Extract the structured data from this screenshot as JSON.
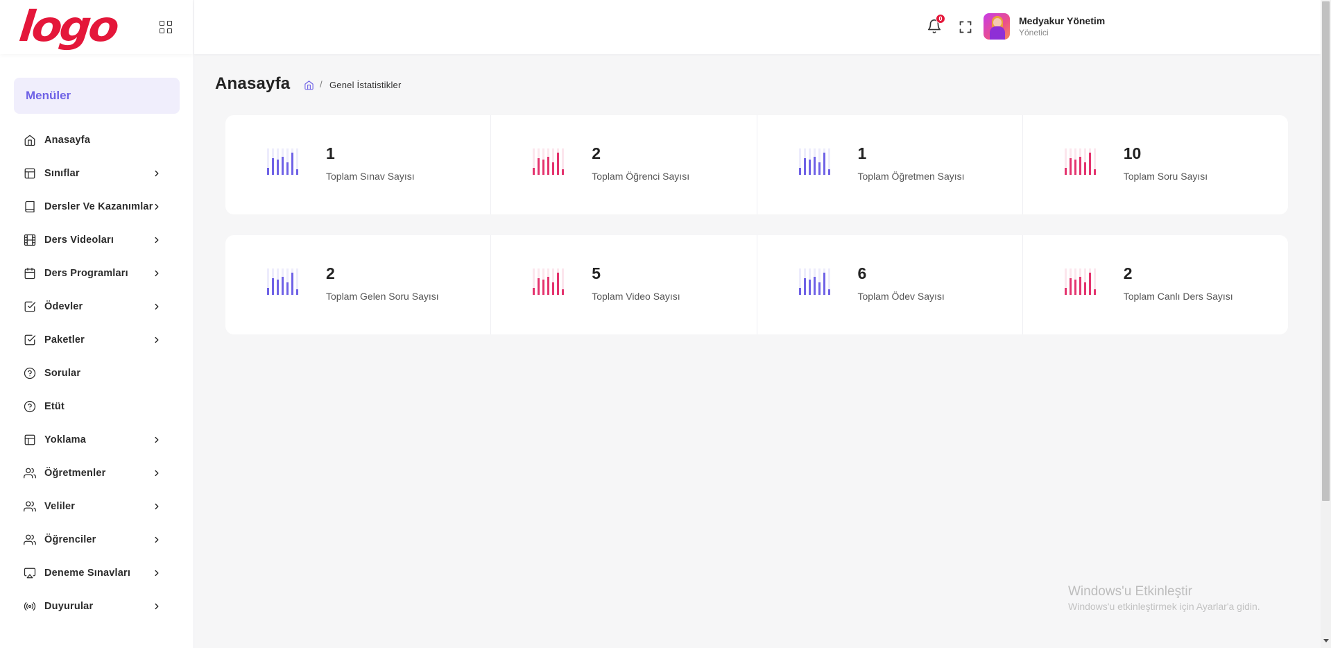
{
  "brand": {
    "logo_text": "logo",
    "logo_color": "#e4173a"
  },
  "colors": {
    "accent": "#6f62e6",
    "purple": "#6f62e6",
    "pink": "#e4336e",
    "brand_red": "#e4173a"
  },
  "sidebar": {
    "menu_header": "Menüler",
    "items": [
      {
        "label": "Anasayfa",
        "icon": "home-icon",
        "has_submenu": false
      },
      {
        "label": "Sınıflar",
        "icon": "layout-icon",
        "has_submenu": true
      },
      {
        "label": "Dersler Ve Kazanımlar",
        "icon": "book-icon",
        "has_submenu": true
      },
      {
        "label": "Ders Videoları",
        "icon": "film-icon",
        "has_submenu": true
      },
      {
        "label": "Ders Programları",
        "icon": "calendar-icon",
        "has_submenu": true
      },
      {
        "label": "Ödevler",
        "icon": "check-square-icon",
        "has_submenu": true
      },
      {
        "label": "Paketler",
        "icon": "check-square-icon",
        "has_submenu": true
      },
      {
        "label": "Sorular",
        "icon": "help-circle-icon",
        "has_submenu": false
      },
      {
        "label": "Etüt",
        "icon": "help-circle-icon",
        "has_submenu": false
      },
      {
        "label": "Yoklama",
        "icon": "layout-icon",
        "has_submenu": true
      },
      {
        "label": "Öğretmenler",
        "icon": "users-icon",
        "has_submenu": true
      },
      {
        "label": "Veliler",
        "icon": "users-icon",
        "has_submenu": true
      },
      {
        "label": "Öğrenciler",
        "icon": "users-icon",
        "has_submenu": true
      },
      {
        "label": "Deneme Sınavları",
        "icon": "airplay-icon",
        "has_submenu": true
      },
      {
        "label": "Duyurular",
        "icon": "broadcast-icon",
        "has_submenu": true
      }
    ]
  },
  "topbar": {
    "notification_count": "0",
    "user_name": "Medyakur Yönetim",
    "user_role": "Yönetici"
  },
  "page": {
    "title": "Anasayfa",
    "breadcrumb_current": "Genel İstatistikler",
    "breadcrumb_separator": "/"
  },
  "stats_row1": [
    {
      "value": "1",
      "label": "Toplam Sınav Sayısı",
      "color": "purple"
    },
    {
      "value": "2",
      "label": "Toplam Öğrenci Sayısı",
      "color": "pink"
    },
    {
      "value": "1",
      "label": "Toplam Öğretmen Sayısı",
      "color": "purple"
    },
    {
      "value": "10",
      "label": "Toplam Soru Sayısı",
      "color": "pink"
    }
  ],
  "stats_row2": [
    {
      "value": "2",
      "label": "Toplam Gelen Soru Sayısı",
      "color": "purple"
    },
    {
      "value": "5",
      "label": "Toplam Video Sayısı",
      "color": "pink"
    },
    {
      "value": "6",
      "label": "Toplam Ödev Sayısı",
      "color": "purple"
    },
    {
      "value": "2",
      "label": "Toplam Canlı Ders Sayısı",
      "color": "pink"
    }
  ],
  "watermark": {
    "title": "Windows'u Etkinleştir",
    "subtitle": "Windows'u etkinleştirmek için Ayarlar'a gidin."
  }
}
